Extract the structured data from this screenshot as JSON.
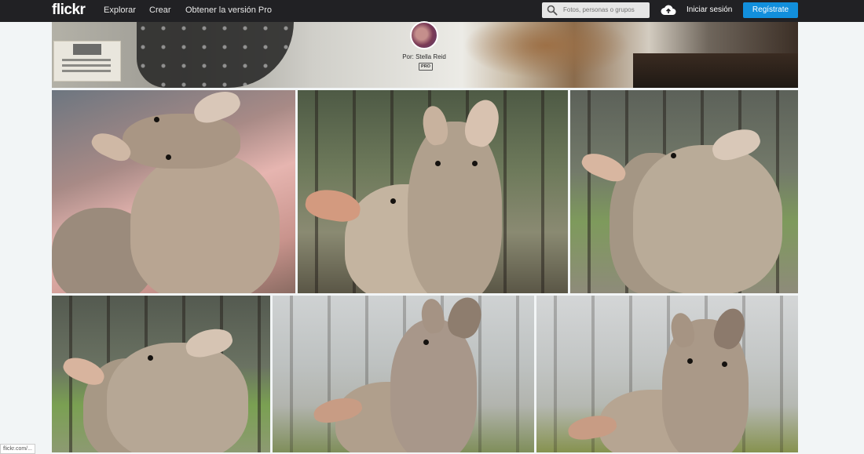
{
  "nav": {
    "logo": "flickr",
    "links": [
      "Explorar",
      "Crear",
      "Obtener la versión Pro"
    ],
    "search_placeholder": "Fotos, personas o grupos",
    "login_label": "Iniciar sesión",
    "signup_label": "Regístrate",
    "colors": {
      "bar": "#212124",
      "signup": "#128fdc"
    }
  },
  "cover": {
    "byline": "Por: Stella Reid",
    "badge": "PRO"
  },
  "photos": [
    {
      "subject": "kangaroo joeys hugging indoors"
    },
    {
      "subject": "two kangaroo joeys in forest"
    },
    {
      "subject": "kangaroo joeys embracing in burnt bushland"
    },
    {
      "subject": "kangaroo joeys hugging on grass"
    },
    {
      "subject": "kangaroo joeys in misty forest"
    },
    {
      "subject": "kangaroo joeys hugging in fog"
    }
  ],
  "footer": {
    "link": "flickr.com/..."
  }
}
